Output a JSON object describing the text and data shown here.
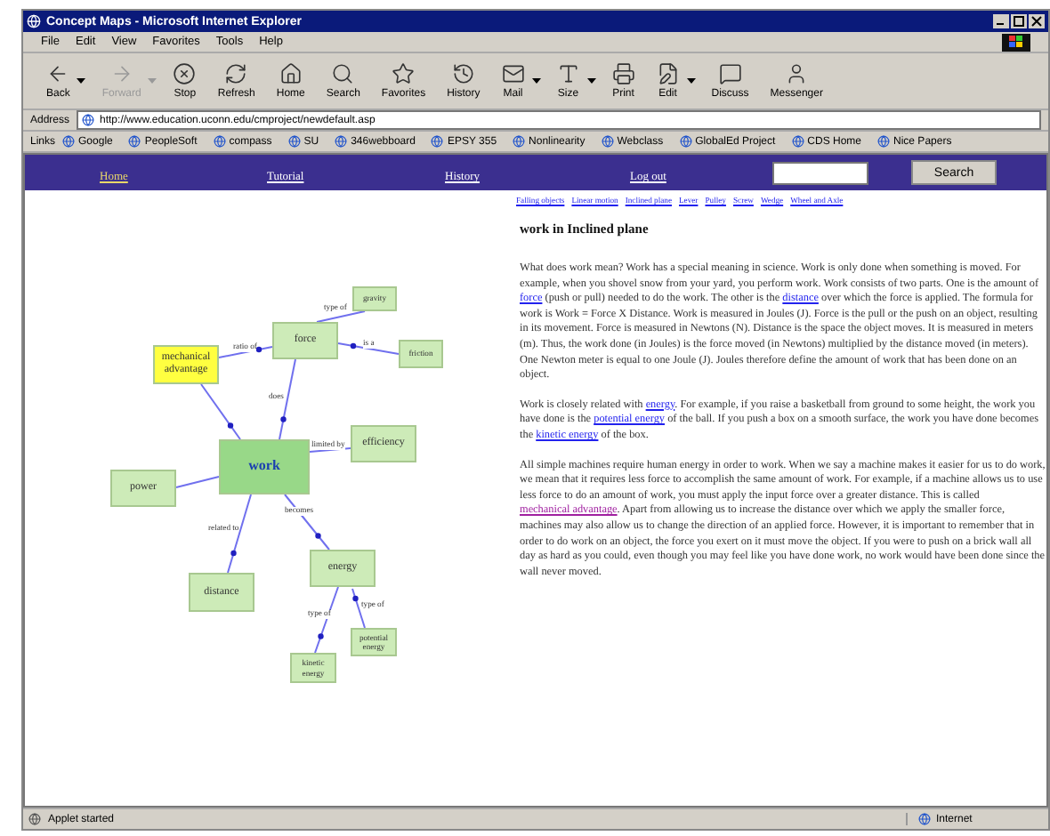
{
  "window": {
    "title": "Concept Maps - Microsoft Internet Explorer"
  },
  "menu": [
    "File",
    "Edit",
    "View",
    "Favorites",
    "Tools",
    "Help"
  ],
  "toolbar": [
    {
      "label": "Back",
      "disabled": false,
      "dropdown": true
    },
    {
      "label": "Forward",
      "disabled": true,
      "dropdown": true
    },
    {
      "label": "Stop",
      "disabled": false,
      "dropdown": false
    },
    {
      "label": "Refresh",
      "disabled": false,
      "dropdown": false
    },
    {
      "label": "Home",
      "disabled": false,
      "dropdown": false
    },
    {
      "label": "Search",
      "disabled": false,
      "dropdown": false
    },
    {
      "label": "Favorites",
      "disabled": false,
      "dropdown": false
    },
    {
      "label": "History",
      "disabled": false,
      "dropdown": false
    },
    {
      "label": "Mail",
      "disabled": false,
      "dropdown": true
    },
    {
      "label": "Size",
      "disabled": false,
      "dropdown": true
    },
    {
      "label": "Print",
      "disabled": false,
      "dropdown": false
    },
    {
      "label": "Edit",
      "disabled": false,
      "dropdown": true
    },
    {
      "label": "Discuss",
      "disabled": false,
      "dropdown": false
    },
    {
      "label": "Messenger",
      "disabled": false,
      "dropdown": false
    }
  ],
  "address": {
    "label": "Address",
    "value": "http://www.education.uconn.edu/cmproject/newdefault.asp"
  },
  "links": {
    "label": "Links",
    "items": [
      "Google",
      "PeopleSoft",
      "compass",
      "SU",
      "346webboard",
      "EPSY 355",
      "Nonlinearity",
      "Webclass",
      "GlobalEd Project",
      "CDS Home",
      "Nice Papers"
    ]
  },
  "nav": {
    "items": [
      {
        "label": "Home",
        "selected": true
      },
      {
        "label": "Tutorial",
        "selected": false
      },
      {
        "label": "History",
        "selected": false
      },
      {
        "label": "Log out",
        "selected": false
      }
    ],
    "search_button": "Search"
  },
  "concept_map": {
    "nodes": [
      {
        "label": "gravity",
        "kind": "small"
      },
      {
        "label": "force",
        "kind": "concept"
      },
      {
        "label": "mechanical advantage",
        "kind": "highlighted"
      },
      {
        "label": "friction",
        "kind": "small"
      },
      {
        "label": "efficiency",
        "kind": "concept"
      },
      {
        "label": "work",
        "kind": "central"
      },
      {
        "label": "power",
        "kind": "concept"
      },
      {
        "label": "distance",
        "kind": "concept"
      },
      {
        "label": "energy",
        "kind": "concept"
      },
      {
        "label": "potential energy",
        "kind": "small"
      },
      {
        "label": "kinetic energy",
        "kind": "small"
      }
    ],
    "edges": [
      {
        "label": "type of",
        "arrow": false
      },
      {
        "label": "ratio of",
        "arrow": true
      },
      {
        "label": "is a",
        "arrow": true
      },
      {
        "label": "does",
        "arrow": true
      },
      {
        "arrow": true
      },
      {
        "label": "limited by",
        "arrow": false
      },
      {
        "arrow": false
      },
      {
        "label": "related to",
        "arrow": true
      },
      {
        "label": "becomes",
        "arrow": true
      },
      {
        "label": "type of",
        "arrow": true
      },
      {
        "label": "type of",
        "arrow": true
      }
    ]
  },
  "topic_links": [
    "Falling objects",
    "Linear motion",
    "Inclined plane",
    "Lever",
    "Pulley",
    "Screw",
    "Wedge",
    "Wheel and Axle"
  ],
  "article": {
    "title": "work in Inclined plane",
    "paragraphs": [
      [
        {
          "text": "What does work mean? Work has a special meaning in science. Work is only done when something is moved. For example, when you shovel snow from your yard, you perform work. Work consists of two parts. One is the amount of "
        },
        {
          "text": "force",
          "link": true,
          "visited": false
        },
        {
          "text": " (push or pull) needed to do the work. The other is the "
        },
        {
          "text": "distance",
          "link": true,
          "visited": false
        },
        {
          "text": " over which the force is applied. The formula for work is Work = Force X Distance. Work is measured in Joules (J). Force is the pull or the push on an object, resulting in its movement. Force is measured in Newtons (N). Distance is the space the object moves. It is measured in meters (m). Thus, the work done (in Joules) is the force moved (in Newtons) multiplied by the distance moved (in meters). One Newton meter is equal to one Joule (J). Joules therefore define the amount of work that has been done on an object."
        }
      ],
      [
        {
          "text": "Work is closely related with "
        },
        {
          "text": "energy",
          "link": true,
          "visited": false
        },
        {
          "text": ". For example, if you raise a basketball from ground to some height, the work you have done is the "
        },
        {
          "text": "potential energy",
          "link": true,
          "visited": false
        },
        {
          "text": " of the ball. If you push a box on a smooth surface, the work you have done becomes the "
        },
        {
          "text": "kinetic energy",
          "link": true,
          "visited": false
        },
        {
          "text": " of the box."
        }
      ],
      [
        {
          "text": "All simple machines require human energy in order to work. When we say a machine makes it easier for us to do work, we mean that it requires less force to accomplish the same amount of work. For example, if a machine allows us to use less force to do an amount of work, you must apply the input force over a greater distance. This is called "
        },
        {
          "text": "mechanical advantage",
          "link": true,
          "visited": true
        },
        {
          "text": ". Apart from allowing us to increase the distance over which we apply the smaller force, machines may also allow us to change the direction of an applied force. However, it is important to remember that in order to do work on an object, the force you exert on it must move the object. If you were to push on a brick wall all day as hard as you could, even though you may feel like you have done work, no work would have been done since the wall never moved."
        }
      ]
    ]
  },
  "status_bar": {
    "text": "Applet started",
    "zone": "Internet"
  }
}
